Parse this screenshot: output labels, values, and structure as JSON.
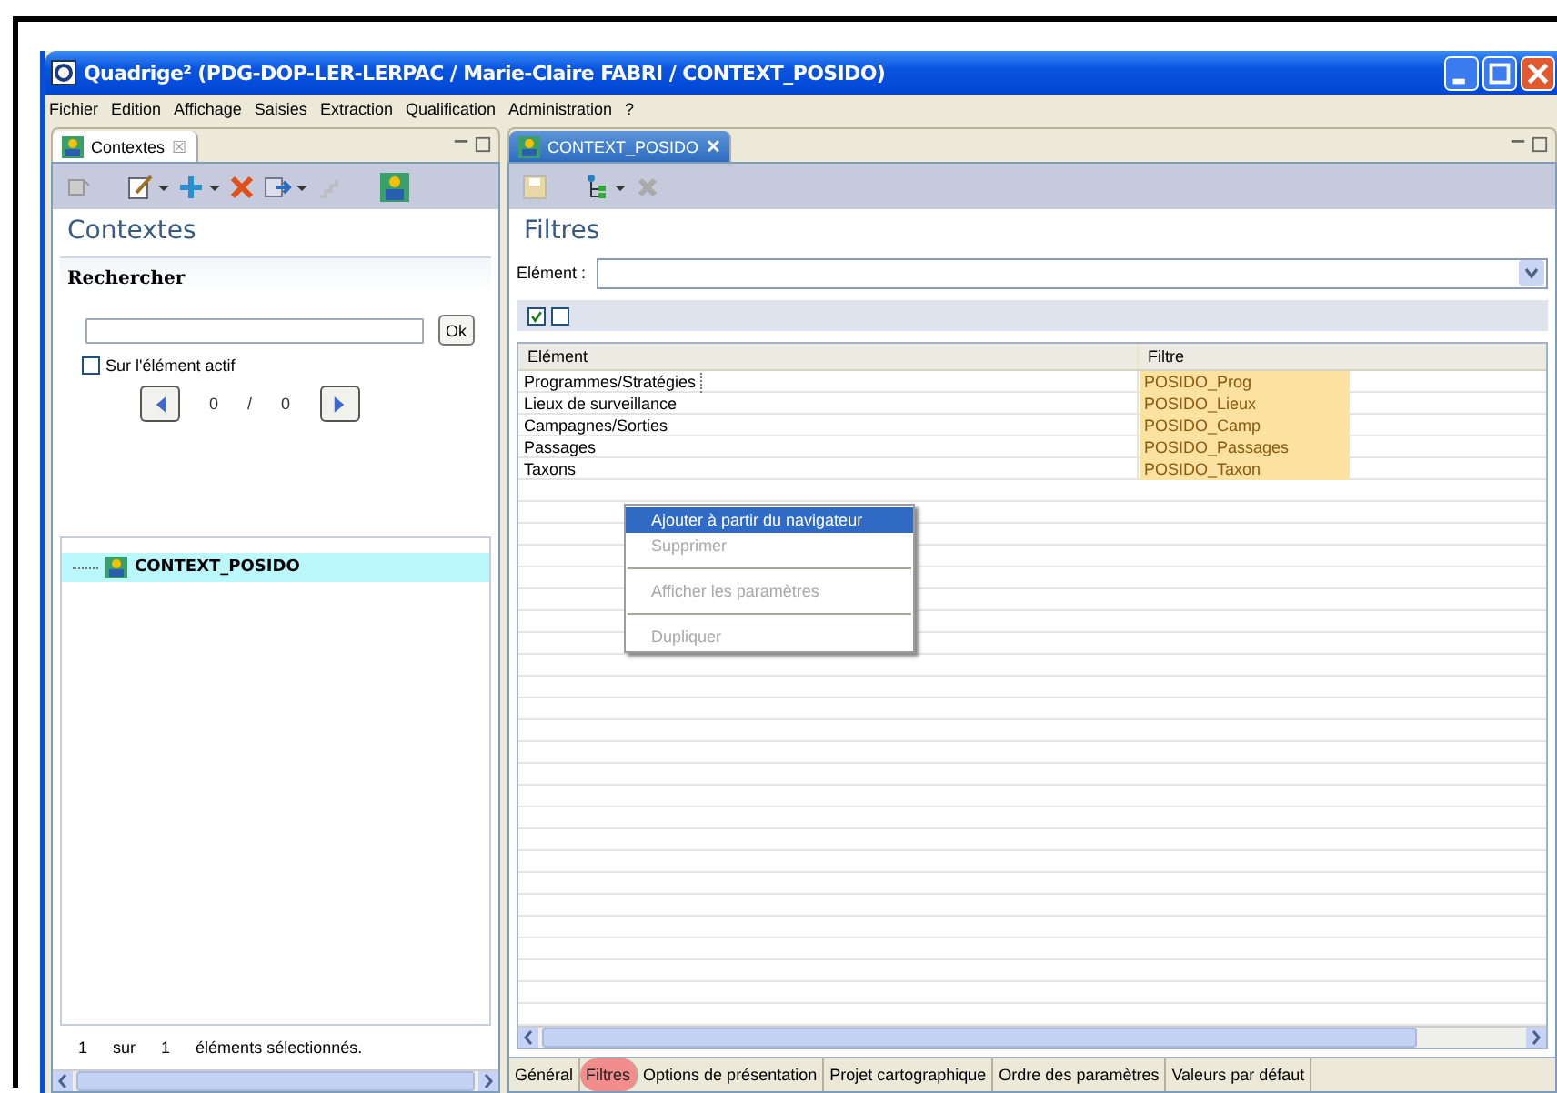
{
  "window": {
    "title": "Quadrige² (PDG-DOP-LER-LERPAC / Marie-Claire FABRI / CONTEXT_POSIDO)"
  },
  "menu": [
    "Fichier",
    "Edition",
    "Affichage",
    "Saisies",
    "Extraction",
    "Qualification",
    "Administration",
    "?"
  ],
  "left_panel": {
    "tab": {
      "label": "Contextes",
      "close": "☒"
    },
    "heading": "Contextes",
    "search": {
      "title": "Rechercher",
      "button": "Ok",
      "checkbox": {
        "label": "Sur l'élément actif",
        "checked": false
      },
      "counter": {
        "current": "0",
        "separator": "/",
        "total": "0"
      }
    },
    "tree": [
      {
        "label": "CONTEXT_POSIDO",
        "selected": true
      }
    ],
    "status": {
      "count": "1",
      "word": "sur",
      "total": "1",
      "text": "éléments sélectionnés."
    }
  },
  "right_panel": {
    "tab": {
      "label": "CONTEXT_POSIDO",
      "close": "✕"
    },
    "heading": "Filtres",
    "element_field": {
      "label": "Elément :"
    },
    "checkboxes": [
      {
        "checked": true
      },
      {
        "checked": false
      }
    ],
    "table": {
      "columns": [
        "Elément",
        "Filtre"
      ],
      "rows": [
        {
          "element": "Programmes/Stratégies",
          "filter": "POSIDO_Prog",
          "selected": true
        },
        {
          "element": "Lieux de surveillance",
          "filter": "POSIDO_Lieux",
          "selected": false
        },
        {
          "element": "Campagnes/Sorties",
          "filter": "POSIDO_Camp",
          "selected": false
        },
        {
          "element": "Passages",
          "filter": "POSIDO_Passages",
          "selected": false
        },
        {
          "element": "Taxons",
          "filter": "POSIDO_Taxon",
          "selected": false
        }
      ]
    },
    "context_menu": [
      {
        "kind": "item",
        "label": "Ajouter à partir du navigateur",
        "selected": true,
        "disabled": false
      },
      {
        "kind": "item",
        "label": "Supprimer",
        "selected": false,
        "disabled": true
      },
      {
        "kind": "separator"
      },
      {
        "kind": "item",
        "label": "Afficher les paramètres",
        "selected": false,
        "disabled": true
      },
      {
        "kind": "separator"
      },
      {
        "kind": "item",
        "label": "Dupliquer",
        "selected": false,
        "disabled": true
      }
    ],
    "bottom_tabs": [
      {
        "label": "Général",
        "selected": false
      },
      {
        "label": "Filtres",
        "selected": true
      },
      {
        "label": "Options de présentation",
        "selected": false
      },
      {
        "label": "Projet cartographique",
        "selected": false
      },
      {
        "label": "Ordre des paramètres",
        "selected": false
      },
      {
        "label": "Valeurs par défaut",
        "selected": false
      }
    ]
  }
}
